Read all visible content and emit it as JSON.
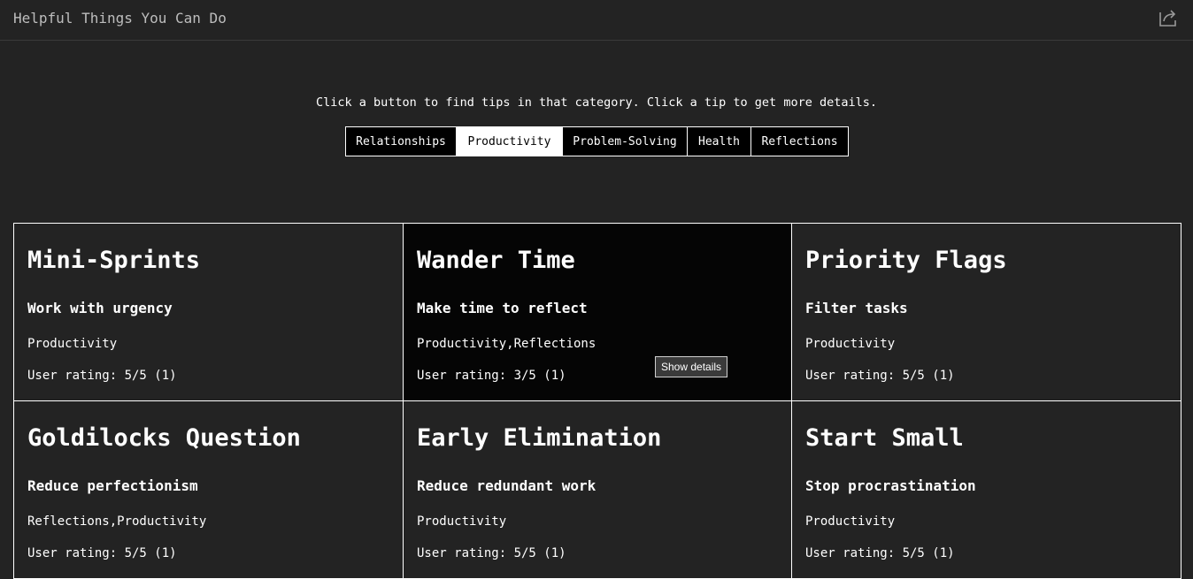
{
  "header": {
    "title": "Helpful Things You Can Do",
    "share_icon": "share-icon"
  },
  "instructions": "Click a button to find tips in that category. Click a tip to get more details.",
  "categories": [
    {
      "label": "Relationships",
      "active": false
    },
    {
      "label": "Productivity",
      "active": true
    },
    {
      "label": "Problem-Solving",
      "active": false
    },
    {
      "label": "Health",
      "active": false
    },
    {
      "label": "Reflections",
      "active": false
    }
  ],
  "tips": [
    {
      "title": "Mini-Sprints",
      "subtitle": "Work with urgency",
      "tags": "Productivity",
      "rating": "User rating: 5/5 (1)"
    },
    {
      "title": "Wander Time",
      "subtitle": "Make time to reflect",
      "tags": "Productivity,Reflections",
      "rating": "User rating: 3/5 (1)",
      "tooltip": "Show details"
    },
    {
      "title": "Priority Flags",
      "subtitle": "Filter tasks",
      "tags": "Productivity",
      "rating": "User rating: 5/5 (1)"
    },
    {
      "title": "Goldilocks Question",
      "subtitle": "Reduce perfectionism",
      "tags": "Reflections,Productivity",
      "rating": "User rating: 5/5 (1)"
    },
    {
      "title": "Early Elimination",
      "subtitle": "Reduce redundant work",
      "tags": "Productivity",
      "rating": "User rating: 5/5 (1)"
    },
    {
      "title": "Start Small",
      "subtitle": "Stop procrastination",
      "tags": "Productivity",
      "rating": "User rating: 5/5 (1)"
    }
  ],
  "colors": {
    "background": "#232323",
    "hover_card": "#050505",
    "border": "#ffffff",
    "active_button_bg": "#ffffff"
  }
}
